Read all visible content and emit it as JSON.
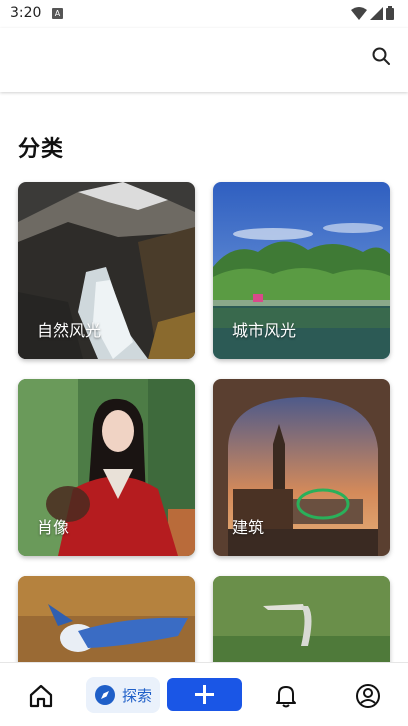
{
  "status_bar": {
    "time": "3:20",
    "notif": "A"
  },
  "section": {
    "title": "分类"
  },
  "categories": [
    {
      "label": "自然风光",
      "icon": "waterfall-mountain"
    },
    {
      "label": "城市风光",
      "icon": "lake-trees"
    },
    {
      "label": "肖像",
      "icon": "portrait-woman"
    },
    {
      "label": "建筑",
      "icon": "big-ben-arch"
    },
    {
      "label": "",
      "icon": "blue-jay-bird"
    },
    {
      "label": "",
      "icon": "heron-bird"
    }
  ],
  "bottom_nav": {
    "explore_label": "探索"
  },
  "colors": {
    "accent": "#1a56e6",
    "explore_bg": "#eaf1fb",
    "explore_text": "#1f5fc8"
  }
}
